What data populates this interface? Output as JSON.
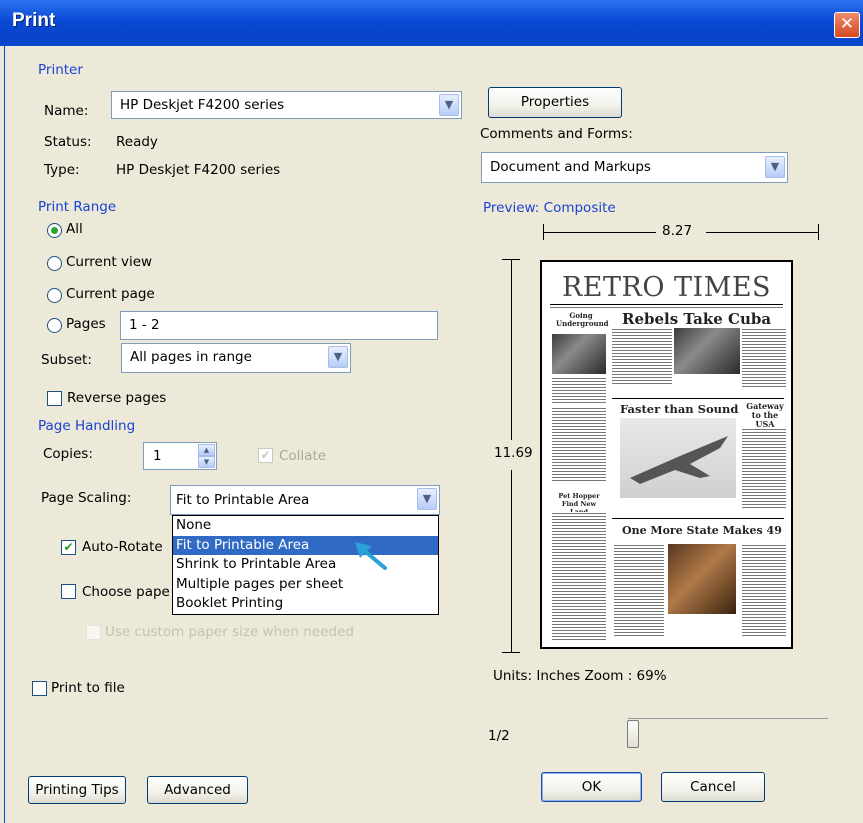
{
  "window": {
    "title": "Print",
    "close_glyph": "✕"
  },
  "printer": {
    "group_label": "Printer",
    "name_label": "Name:",
    "name_value": "HP Deskjet F4200 series",
    "status_label": "Status:",
    "status_value": "Ready",
    "type_label": "Type:",
    "type_value": "HP Deskjet F4200 series",
    "properties_button": "Properties",
    "comments_label": "Comments and Forms:",
    "comments_value": "Document and Markups"
  },
  "print_range": {
    "group_label": "Print Range",
    "options": [
      "All",
      "Current view",
      "Current page",
      "Pages"
    ],
    "selected": "All",
    "pages_value": "1 - 2",
    "subset_label": "Subset:",
    "subset_value": "All pages in range",
    "reverse_label": "Reverse pages",
    "reverse_checked": false
  },
  "page_handling": {
    "group_label": "Page Handling",
    "copies_label": "Copies:",
    "copies_value": "1",
    "collate_label": "Collate",
    "collate_checked": true,
    "collate_enabled": false,
    "scaling_label": "Page Scaling:",
    "scaling_value": "Fit to Printable Area",
    "scaling_options": [
      "None",
      "Fit to Printable Area",
      "Shrink to Printable Area",
      "Multiple pages per sheet",
      "Booklet Printing"
    ],
    "scaling_highlighted": "Fit to Printable Area",
    "auto_rotate_label": "Auto-Rotate",
    "auto_rotate_checked": true,
    "choose_paper_label": "Choose pape",
    "choose_paper_checked": false,
    "custom_paper_label": "Use custom paper size when needed"
  },
  "print_to_file_label": "Print to file",
  "preview": {
    "label": "Preview: Composite",
    "width_value": "8.27",
    "height_value": "11.69",
    "units_zoom": "Units: Inches Zoom :  69%",
    "page_indicator": "1/2",
    "newspaper": {
      "masthead": "RETRO TIMES",
      "headline_1": "Rebels Take Cuba",
      "headline_2": "Faster than Sound",
      "headline_3": "One More State Makes 49",
      "side_1": "Going Underground",
      "side_2": "Gateway to the USA",
      "side_3": "Pet Hopper Find New Land"
    }
  },
  "footer": {
    "printing_tips": "Printing Tips",
    "advanced": "Advanced",
    "ok": "OK",
    "cancel": "Cancel"
  },
  "colors": {
    "title_bar": "#0a4ad6",
    "group_label": "#1a43d1",
    "selection": "#316ac5",
    "cursor_arrow": "#2a9fd8"
  },
  "icons": [
    "close-icon",
    "chevron-down-icon",
    "spin-up-icon",
    "spin-down-icon",
    "mouse-cursor-arrow-icon"
  ]
}
